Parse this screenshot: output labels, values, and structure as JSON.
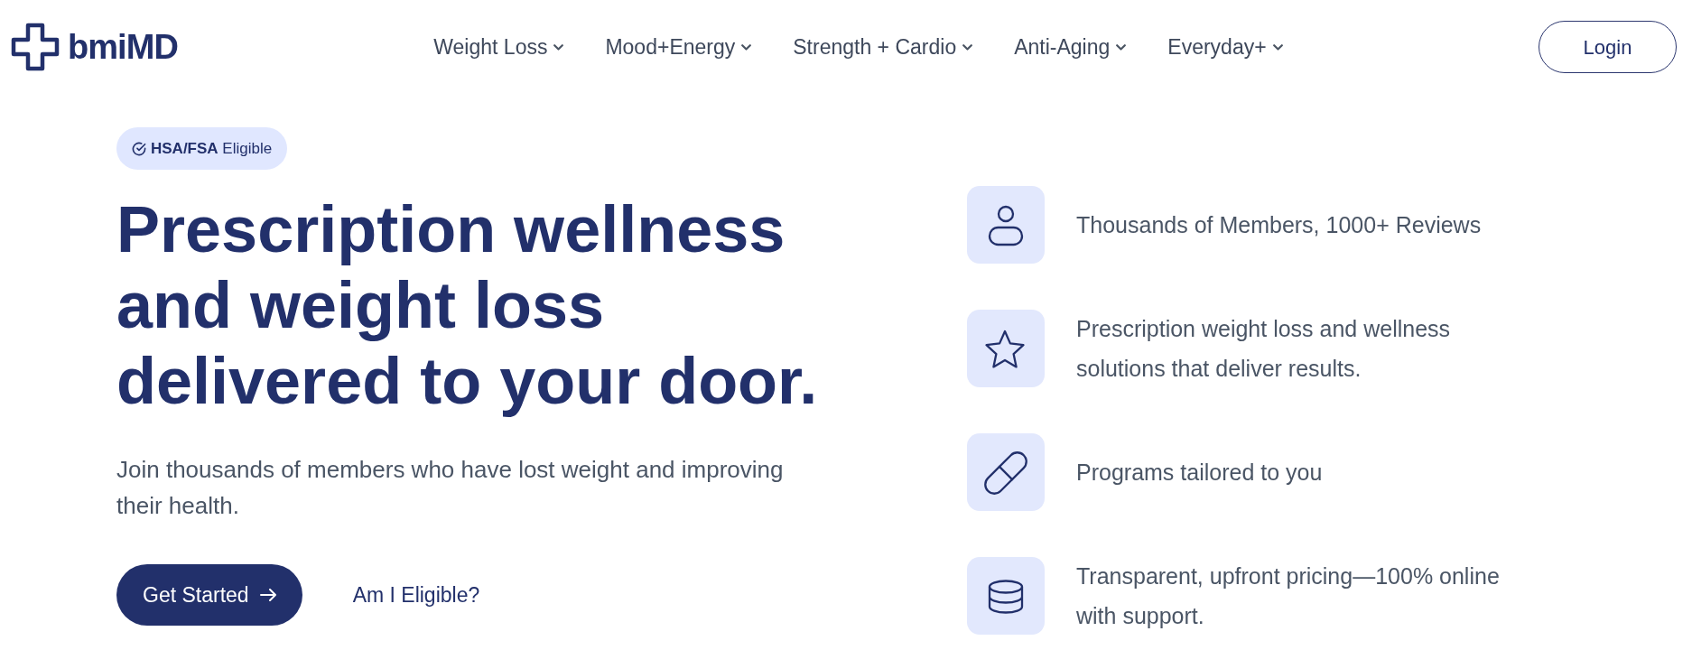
{
  "header": {
    "logo": "bmiMD",
    "nav": [
      {
        "label": "Weight Loss",
        "dropdown": true
      },
      {
        "label": "Mood+Energy",
        "dropdown": true
      },
      {
        "label": "Strength + Cardio",
        "dropdown": true
      },
      {
        "label": "Anti-Aging",
        "dropdown": true
      },
      {
        "label": "Everyday+",
        "dropdown": true
      }
    ],
    "login_button": "Login"
  },
  "hero": {
    "badge": "**HSA/FSA** Eligible",
    "headline": "Prescription wellness and weight loss delivered to your door.",
    "subtitle": "Join thousands of members who have lost weight and improving their health.",
    "primary_button": "Get Started",
    "secondary_link": "Am I Eligible?"
  },
  "features": [
    "Thousands of Members, 1000+ Reviews",
    "Prescription weight loss and wellness solutions that deliver results.",
    "Programs tailored to you",
    "Transparent, upfront pricing—100% online with support."
  ]
}
